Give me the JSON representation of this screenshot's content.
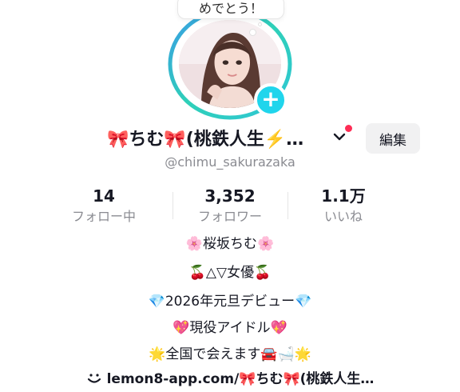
{
  "bubble": {
    "text": "めでとう！"
  },
  "profile": {
    "display_name": "🎀ちむ🎀(桃鉄人生⚡️…",
    "username": "@chimu_sakurazaka",
    "edit_label": "編集"
  },
  "stats": [
    {
      "value": "14",
      "label": "フォロー中"
    },
    {
      "value": "3,352",
      "label": "フォロワー"
    },
    {
      "value": "1.1万",
      "label": "いいね"
    }
  ],
  "bio": [
    "🌸桜坂ちむ🌸",
    "🍒△▽女優🍒",
    "💎2026年元旦デビュー💎",
    "💖現役アイドル💖",
    "🌟全国で会えます🚘🛁🌟"
  ],
  "link": {
    "text": "lemon8-app.com/🎀ちむ🎀(桃鉄人生…"
  },
  "colors": {
    "accent": "#20d5ec",
    "notify": "#fe2c55",
    "muted": "#8a8b91",
    "button_bg": "#f1f1f2"
  },
  "icons": {
    "add": "plus-icon",
    "chevron": "chevron-down-icon",
    "link": "lemon8-icon"
  }
}
